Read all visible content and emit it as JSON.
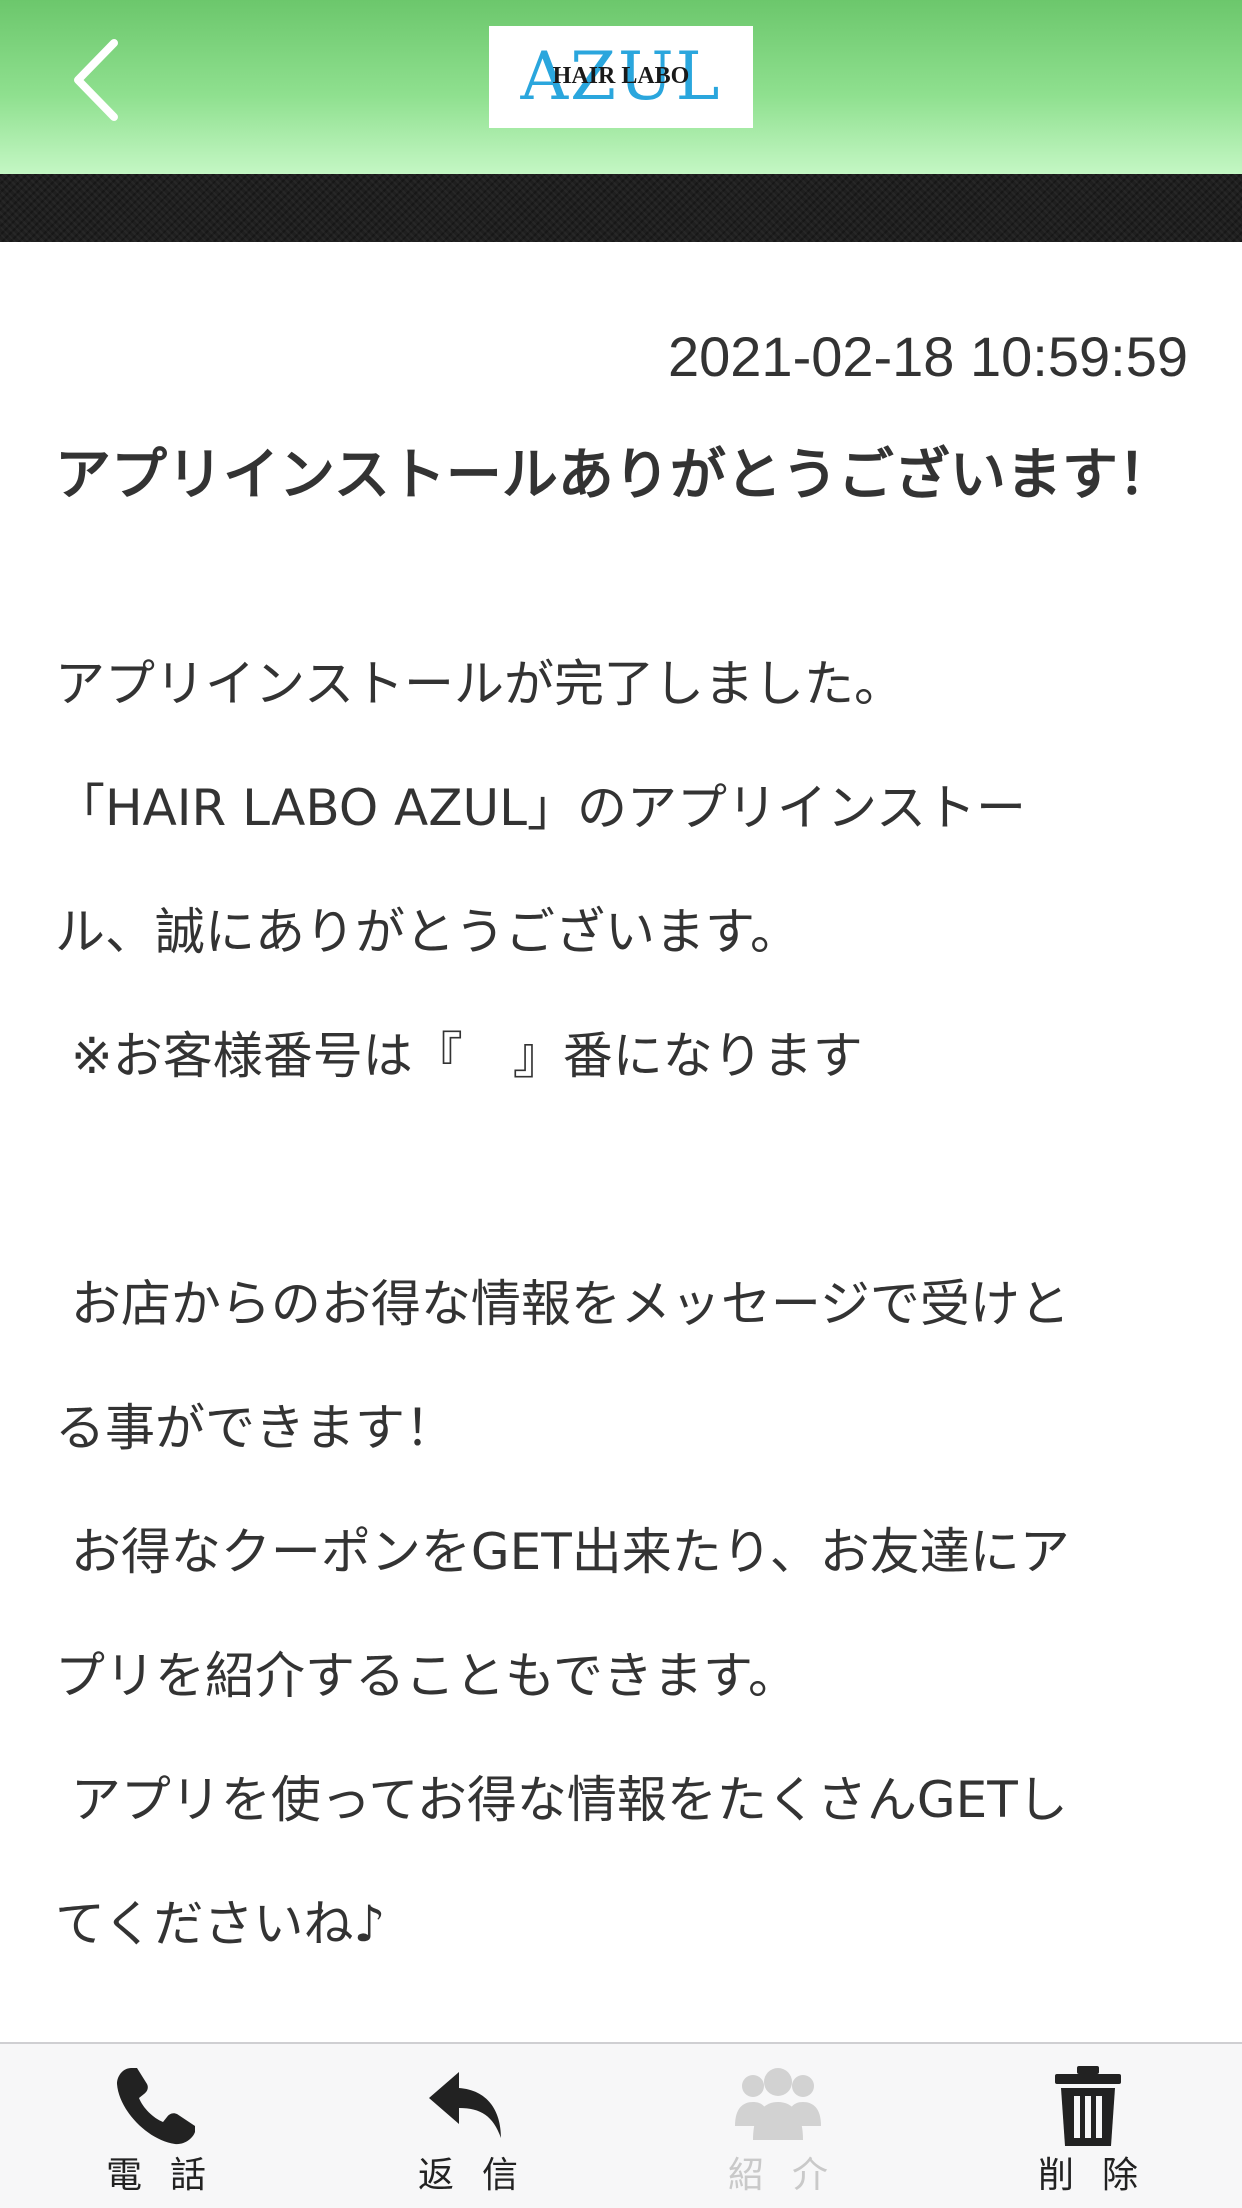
{
  "header": {
    "logo_main": "AZUL",
    "logo_sub": "HAIR LABO",
    "back_icon": "chevron-left-icon",
    "colors": {
      "header_top": "#6cc76c",
      "header_bottom": "#c4f7c4",
      "logo_blue": "#2aa6dd",
      "band": "#1f1f1f"
    }
  },
  "message": {
    "timestamp": "2021-02-18 10:59:59",
    "title": "アプリインストールありがとうございます！",
    "body_lines": [
      "アプリインストールが完了しました。",
      "「HAIR LABO AZUL」のアプリインストー",
      "ル、誠にありがとうございます。",
      " ※お客様番号は『　』番になります",
      "",
      " お店からのお得な情報をメッセージで受けと",
      "る事ができます！",
      " お得なクーポンをGET出来たり、お友達にア",
      "プリを紹介することもできます。",
      " アプリを使ってお得な情報をたくさんGETし",
      "てくださいね♪"
    ]
  },
  "tabbar": {
    "items": [
      {
        "label": "電話",
        "icon": "phone-icon",
        "enabled": true
      },
      {
        "label": "返信",
        "icon": "reply-icon",
        "enabled": true
      },
      {
        "label": "紹介",
        "icon": "group-icon",
        "enabled": false
      },
      {
        "label": "削除",
        "icon": "trash-icon",
        "enabled": true
      }
    ],
    "colors": {
      "enabled": "#222222",
      "disabled": "#c9c9c9"
    }
  }
}
